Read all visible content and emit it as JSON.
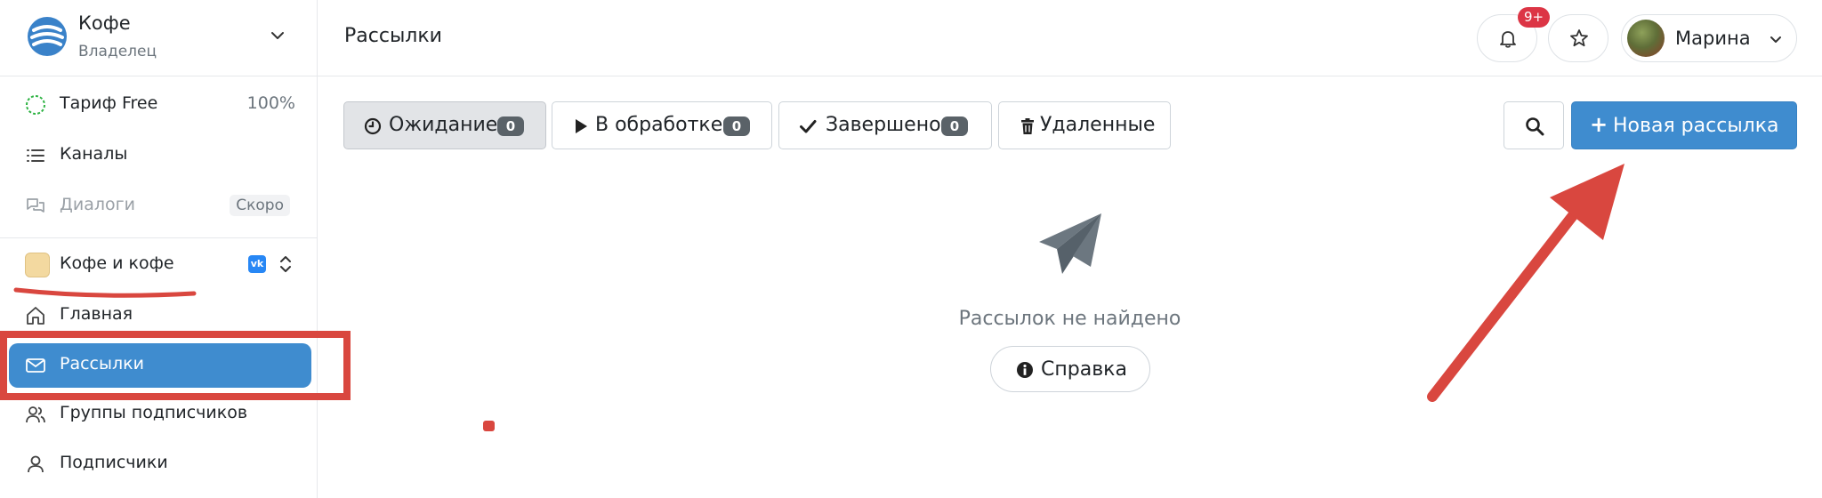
{
  "brand": {
    "name": "Кофе",
    "role": "Владелец"
  },
  "sidebar": {
    "tariff": {
      "label": "Тариф Free",
      "value": "100%"
    },
    "channels": {
      "label": "Каналы"
    },
    "dialogs": {
      "label": "Диалоги",
      "badge": "Скоро"
    },
    "project": {
      "label": "Кофе и кофе",
      "network": "VK"
    },
    "items": [
      {
        "label": "Главная",
        "icon": "home-icon"
      },
      {
        "label": "Рассылки",
        "icon": "envelope-icon",
        "active": true
      },
      {
        "label": "Группы подписчиков",
        "icon": "users-icon"
      },
      {
        "label": "Подписчики",
        "icon": "user-icon"
      }
    ]
  },
  "header": {
    "title": "Рассылки",
    "notifications_badge": "9+",
    "user_name": "Марина"
  },
  "tabs": [
    {
      "label": "Ожидание",
      "count": "0",
      "icon": "clock-icon",
      "active": true
    },
    {
      "label": "В обработке",
      "count": "0",
      "icon": "play-icon"
    },
    {
      "label": "Завершено",
      "count": "0",
      "icon": "check-icon"
    },
    {
      "label": "Удаленные",
      "icon": "trash-icon"
    }
  ],
  "actions": {
    "new_mailing": "Новая рассылка"
  },
  "empty_state": {
    "message": "Рассылок не найдено",
    "help_label": "Справка"
  },
  "colors": {
    "accent": "#3f8ccf",
    "badge_red": "#dc3545",
    "annotation_red": "#d9473f"
  }
}
